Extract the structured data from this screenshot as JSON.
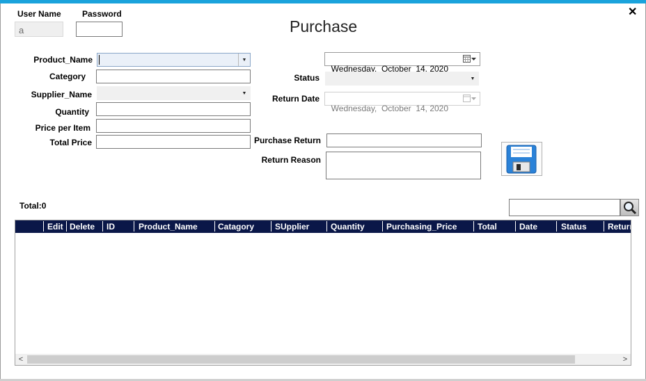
{
  "window": {
    "title": "Purchase",
    "close_glyph": "✕"
  },
  "login": {
    "username_label": "User Name",
    "username_value": "a",
    "password_label": "Password",
    "password_value": ""
  },
  "form": {
    "product_name_label": "Product_Name",
    "category_label": "Category",
    "supplier_name_label": "Supplier_Name",
    "quantity_label": "Quantity",
    "price_per_item_label": "Price per Item",
    "total_price_label": "Total Price",
    "status_label": "Status",
    "return_date_label": "Return Date",
    "purchase_return_label": "Purchase Return",
    "return_reason_label": "Return Reason",
    "purchase_date": {
      "day": "Wednesday,",
      "month": "October",
      "date": "14, 2020"
    },
    "return_date": {
      "day": "Wednesday,",
      "month": "October",
      "date": "14, 2020"
    }
  },
  "summary": {
    "total_text": "Total:0"
  },
  "search": {
    "value": ""
  },
  "grid": {
    "columns": [
      "Edit",
      "Delete",
      "ID",
      "Product_Name",
      "Catagory",
      "SUpplier",
      "Quantity",
      "Purchasing_Price",
      "Total",
      "Date",
      "Status",
      "Return"
    ]
  },
  "scroll": {
    "left_arrow": "<",
    "right_arrow": ">"
  },
  "colors": {
    "accent_bar": "#1aa3dc",
    "grid_header": "#0a1748",
    "save_icon": "#2a82d8"
  },
  "icons": {
    "save": "floppy-disk-icon",
    "search": "magnifier-icon",
    "calendar": "calendar-icon",
    "close": "close-icon"
  }
}
